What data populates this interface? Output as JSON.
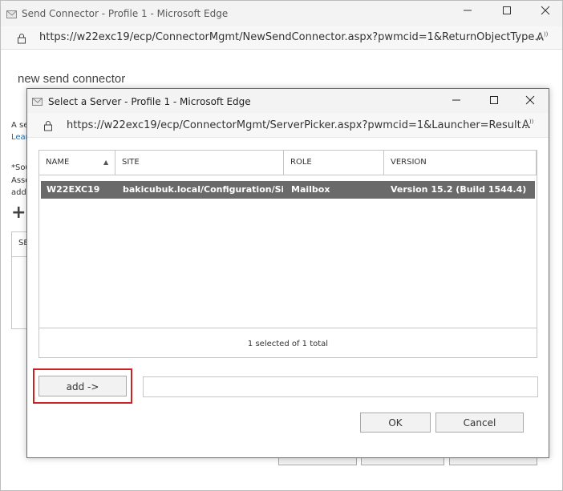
{
  "outer_window": {
    "title": "Send Connector - Profile 1 - Microsoft Edge",
    "url": "https://w22exc19/ecp/ConnectorMgmt/NewSendConnector.aspx?pwmcid=1&ReturnObjectType...",
    "heading": "new send connector",
    "fragments": {
      "line1": "A se",
      "line2": "Lear",
      "line3": "*Sou",
      "line4": "Asso",
      "line5": "add",
      "plus": "+",
      "col": "SE"
    }
  },
  "dialog": {
    "title": "Select a Server - Profile 1 - Microsoft Edge",
    "url": "https://w22exc19/ecp/ConnectorMgmt/ServerPicker.aspx?pwmcid=1&Launcher=Result...",
    "grid": {
      "columns": [
        "NAME",
        "SITE",
        "ROLE",
        "VERSION"
      ],
      "sort_indicator": "▲",
      "rows": [
        {
          "name": "W22EXC19",
          "site": "bakicubuk.local/Configuration/Site...",
          "role": "Mailbox",
          "version": "Version 15.2 (Build 1544.4)"
        }
      ],
      "status": "1 selected of 1 total"
    },
    "add_button": "add ->",
    "ok_button": "OK",
    "cancel_button": "Cancel"
  },
  "icons": {
    "window": "window-icon",
    "lock": "lock-icon",
    "reader": "read-aloud-icon",
    "minimize": "minimize-icon",
    "maximize": "maximize-icon",
    "close": "close-icon"
  },
  "colors": {
    "selected_row": "#6a6a6a",
    "highlight": "#cc2222"
  }
}
